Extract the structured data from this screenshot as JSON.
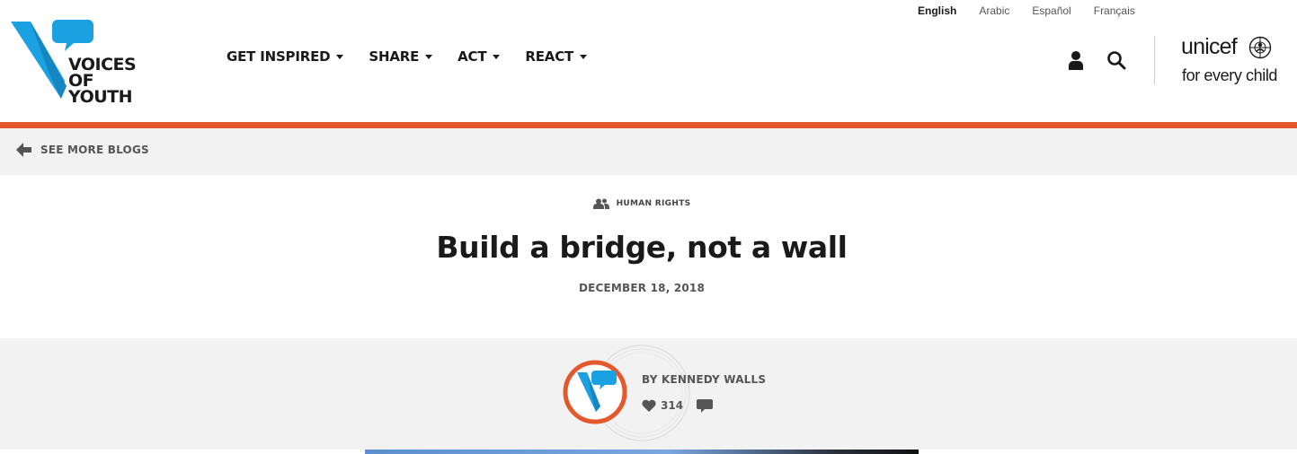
{
  "languages": [
    {
      "label": "English",
      "active": true
    },
    {
      "label": "Arabic",
      "active": false
    },
    {
      "label": "Español",
      "active": false
    },
    {
      "label": "Français",
      "active": false
    }
  ],
  "logo": {
    "text": "VOICES\nOF YOUTH",
    "accent_color": "#1ba0e1"
  },
  "nav": {
    "items": [
      {
        "label": "GET INSPIRED"
      },
      {
        "label": "SHARE"
      },
      {
        "label": "ACT"
      },
      {
        "label": "REACT"
      }
    ]
  },
  "unicef": {
    "name": "unicef",
    "tagline": "for every child"
  },
  "colors": {
    "accent": "#e4582b",
    "brand_blue": "#1ba0e1",
    "band_gray": "#f2f2f2"
  },
  "breadcrumb": {
    "label": "SEE MORE BLOGS"
  },
  "article": {
    "category": "HUMAN RIGHTS",
    "title": "Build a bridge, not a wall",
    "date": "DECEMBER 18, 2018",
    "author": "BY KENNEDY WALLS",
    "likes": "314"
  }
}
